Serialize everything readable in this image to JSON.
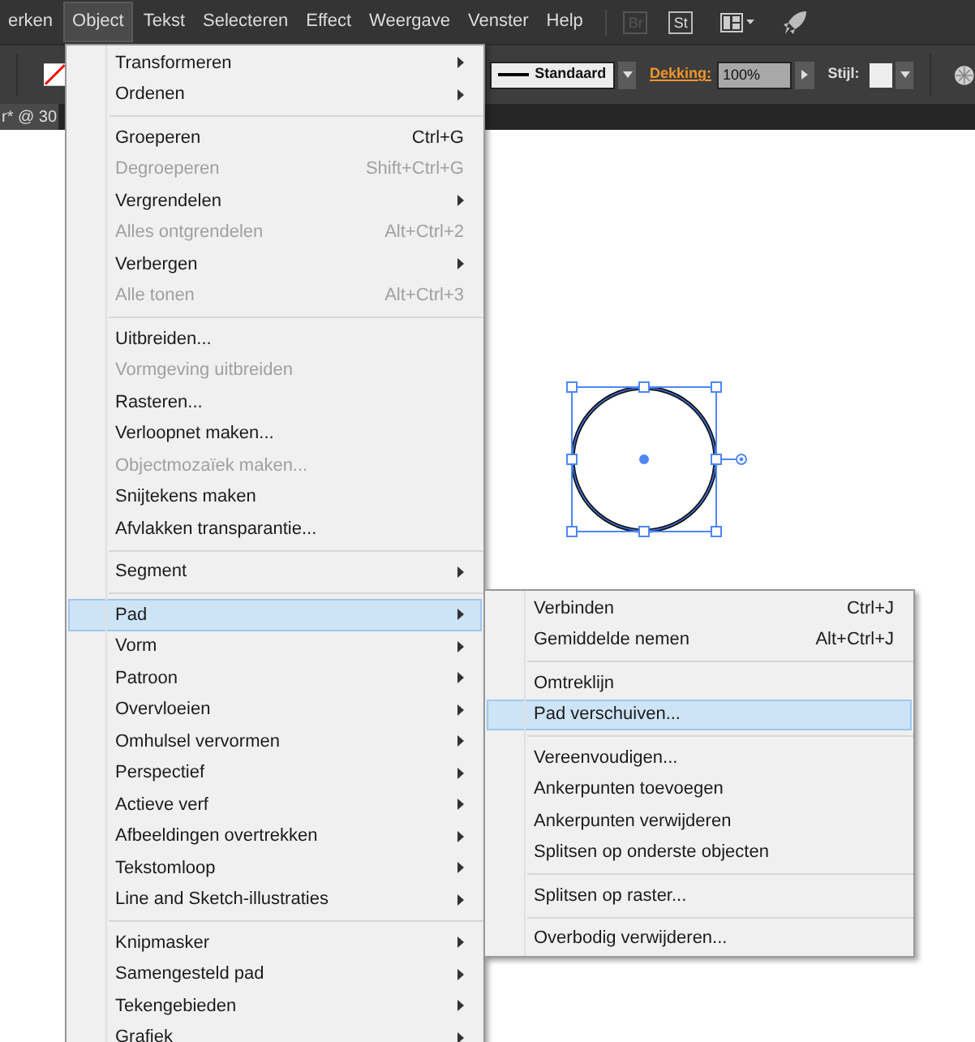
{
  "menubar": [
    {
      "label": "erken",
      "selected": false
    },
    {
      "label": "Object",
      "selected": true
    },
    {
      "label": "Tekst",
      "selected": false
    },
    {
      "label": "Selecteren",
      "selected": false
    },
    {
      "label": "Effect",
      "selected": false
    },
    {
      "label": "Weergave",
      "selected": false
    },
    {
      "label": "Venster",
      "selected": false
    },
    {
      "label": "Help",
      "selected": false
    }
  ],
  "app_buttons": [
    "Br",
    "St"
  ],
  "control_bar": {
    "stroke_profile": "Standaard",
    "opacity_label": "Dekking:",
    "opacity_value": "100%",
    "style_label": "Stijl:"
  },
  "document_tab": {
    "title": "r* @ 30"
  },
  "object_menu": [
    [
      {
        "label": "Transformeren",
        "submenu": true,
        "disabled": false,
        "selected": false
      },
      {
        "label": "Ordenen",
        "submenu": true,
        "disabled": false,
        "selected": false
      }
    ],
    [
      {
        "label": "Groeperen",
        "shortcut": "Ctrl+G",
        "submenu": false,
        "disabled": false,
        "selected": false
      },
      {
        "label": "Degroeperen",
        "shortcut": "Shift+Ctrl+G",
        "submenu": false,
        "disabled": true,
        "selected": false
      },
      {
        "label": "Vergrendelen",
        "submenu": true,
        "disabled": false,
        "selected": false
      },
      {
        "label": "Alles ontgrendelen",
        "shortcut": "Alt+Ctrl+2",
        "submenu": false,
        "disabled": true,
        "selected": false
      },
      {
        "label": "Verbergen",
        "submenu": true,
        "disabled": false,
        "selected": false
      },
      {
        "label": "Alle tonen",
        "shortcut": "Alt+Ctrl+3",
        "submenu": false,
        "disabled": true,
        "selected": false
      }
    ],
    [
      {
        "label": "Uitbreiden...",
        "submenu": false,
        "disabled": false,
        "selected": false
      },
      {
        "label": "Vormgeving uitbreiden",
        "submenu": false,
        "disabled": true,
        "selected": false
      },
      {
        "label": "Rasteren...",
        "submenu": false,
        "disabled": false,
        "selected": false
      },
      {
        "label": "Verloopnet maken...",
        "submenu": false,
        "disabled": false,
        "selected": false
      },
      {
        "label": "Objectmozaïek maken...",
        "submenu": false,
        "disabled": true,
        "selected": false
      },
      {
        "label": "Snijtekens maken",
        "submenu": false,
        "disabled": false,
        "selected": false
      },
      {
        "label": "Afvlakken transparantie...",
        "submenu": false,
        "disabled": false,
        "selected": false
      }
    ],
    [
      {
        "label": "Segment",
        "submenu": true,
        "disabled": false,
        "selected": false
      }
    ],
    [
      {
        "label": "Pad",
        "submenu": true,
        "disabled": false,
        "selected": true
      },
      {
        "label": "Vorm",
        "submenu": true,
        "disabled": false,
        "selected": false
      },
      {
        "label": "Patroon",
        "submenu": true,
        "disabled": false,
        "selected": false
      },
      {
        "label": "Overvloeien",
        "submenu": true,
        "disabled": false,
        "selected": false
      },
      {
        "label": "Omhulsel vervormen",
        "submenu": true,
        "disabled": false,
        "selected": false
      },
      {
        "label": "Perspectief",
        "submenu": true,
        "disabled": false,
        "selected": false
      },
      {
        "label": "Actieve verf",
        "submenu": true,
        "disabled": false,
        "selected": false
      },
      {
        "label": "Afbeeldingen overtrekken",
        "submenu": true,
        "disabled": false,
        "selected": false
      },
      {
        "label": "Tekstomloop",
        "submenu": true,
        "disabled": false,
        "selected": false
      },
      {
        "label": "Line and Sketch-illustraties",
        "submenu": true,
        "disabled": false,
        "selected": false
      }
    ],
    [
      {
        "label": "Knipmasker",
        "submenu": true,
        "disabled": false,
        "selected": false
      },
      {
        "label": "Samengesteld pad",
        "submenu": true,
        "disabled": false,
        "selected": false
      },
      {
        "label": "Tekengebieden",
        "submenu": true,
        "disabled": false,
        "selected": false
      },
      {
        "label": "Grafiek",
        "submenu": true,
        "disabled": false,
        "selected": false
      }
    ]
  ],
  "path_submenu": [
    [
      {
        "label": "Verbinden",
        "shortcut": "Ctrl+J",
        "submenu": false,
        "disabled": false,
        "selected": false
      },
      {
        "label": "Gemiddelde nemen",
        "shortcut": "Alt+Ctrl+J",
        "submenu": false,
        "disabled": false,
        "selected": false
      }
    ],
    [
      {
        "label": "Omtreklijn",
        "submenu": false,
        "disabled": false,
        "selected": false
      },
      {
        "label": "Pad verschuiven...",
        "submenu": false,
        "disabled": false,
        "selected": true
      }
    ],
    [
      {
        "label": "Vereenvoudigen...",
        "submenu": false,
        "disabled": false,
        "selected": false
      },
      {
        "label": "Ankerpunten toevoegen",
        "submenu": false,
        "disabled": false,
        "selected": false
      },
      {
        "label": "Ankerpunten verwijderen",
        "submenu": false,
        "disabled": false,
        "selected": false
      },
      {
        "label": "Splitsen op onderste objecten",
        "submenu": false,
        "disabled": false,
        "selected": false
      }
    ],
    [
      {
        "label": "Splitsen op raster...",
        "submenu": false,
        "disabled": false,
        "selected": false
      }
    ],
    [
      {
        "label": "Overbodig verwijderen...",
        "submenu": false,
        "disabled": false,
        "selected": false
      }
    ]
  ]
}
